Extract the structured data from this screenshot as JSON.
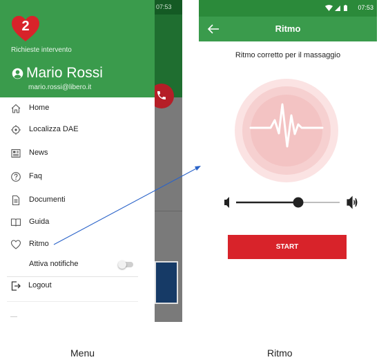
{
  "colors": {
    "green": "#3a9b4c",
    "dark_green": "#2b8a3a",
    "red": "#d8232a",
    "pulse_ring": "#f3c3c3"
  },
  "menu_screen": {
    "background_app": {
      "status_time": "07:53"
    },
    "drawer": {
      "header": {
        "requests_count": "2",
        "requests_label": "Richieste intervento",
        "user_name": "Mario Rossi",
        "user_email": "mario.rossi@libero.it"
      },
      "items": [
        {
          "label": "Home",
          "icon": "home-icon"
        },
        {
          "label": "Localizza DAE",
          "icon": "locate-icon"
        },
        {
          "label": "News",
          "icon": "news-icon"
        },
        {
          "label": "Faq",
          "icon": "help-icon"
        },
        {
          "label": "Documenti",
          "icon": "document-icon"
        },
        {
          "label": "Guida",
          "icon": "book-icon"
        },
        {
          "label": "Ritmo",
          "icon": "heart-outline-icon"
        }
      ],
      "notifications": {
        "label": "Attiva notifiche",
        "enabled": false
      },
      "logout_label": "Logout"
    }
  },
  "ritmo_screen": {
    "status_time": "07:53",
    "title": "Ritmo",
    "caption": "Ritmo corretto per il massaggio",
    "volume_level": 0.6,
    "start_label": "START"
  },
  "captions": {
    "menu": "Menu",
    "ritmo": "Ritmo"
  }
}
